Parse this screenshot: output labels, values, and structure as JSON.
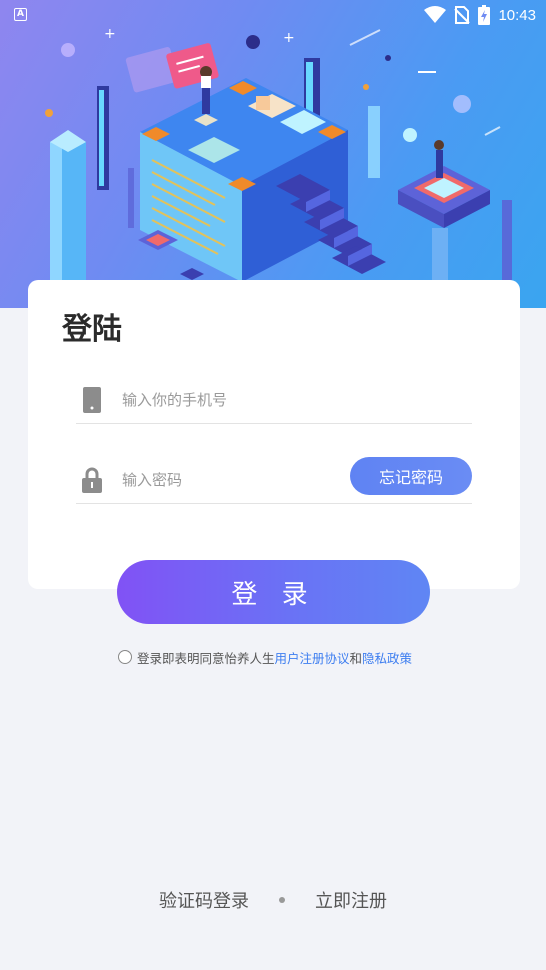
{
  "status_bar": {
    "time": "10:43",
    "app_icon_letter": "A",
    "icons": [
      "wifi-icon",
      "no-sim-icon",
      "battery-charging-icon"
    ]
  },
  "hero": {
    "illustration": "isometric-data-center-illustration"
  },
  "login_card": {
    "title": "登陆",
    "phone_placeholder": "输入你的手机号",
    "phone_icon": "phone-icon",
    "password_placeholder": "输入密码",
    "password_icon": "lock-icon",
    "forgot_label": "忘记密码"
  },
  "login_button": "登 录",
  "agreement": {
    "prefix": "登录即表明同意怡养人生",
    "user_agreement": "用户注册协议",
    "and": "和",
    "privacy_policy": "隐私政策"
  },
  "bottom": {
    "sms_login": "验证码登录",
    "register": "立即注册"
  },
  "colors": {
    "primary": "#5f83f3",
    "login_gradient_start": "#8152f5",
    "link": "#3e7ef0",
    "background": "#f2f3f8"
  }
}
